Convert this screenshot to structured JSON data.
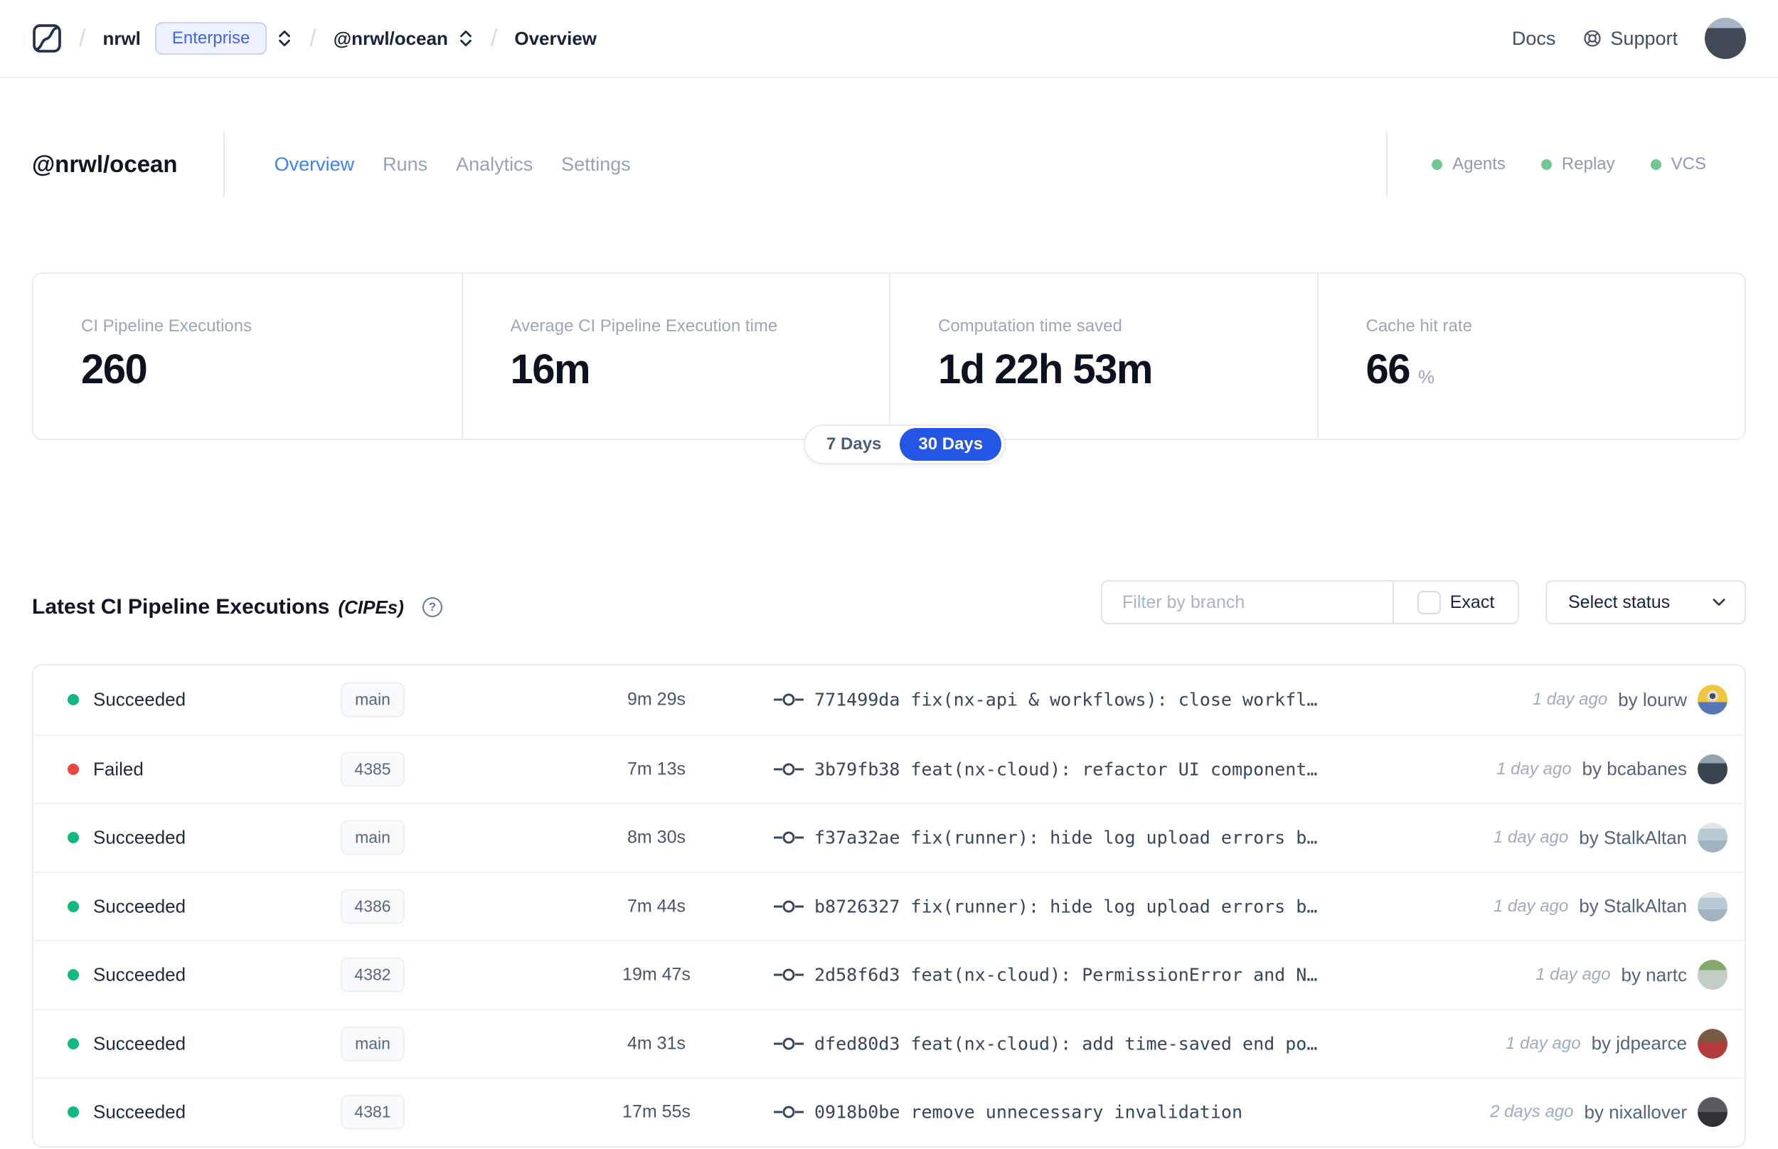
{
  "nav": {
    "breadcrumb": {
      "org": "nrwl",
      "org_badge": "Enterprise",
      "workspace": "@nrwl/ocean",
      "page": "Overview"
    },
    "links": {
      "docs": "Docs",
      "support": "Support"
    },
    "avatar_bg": "linear-gradient(180deg, #a7b6c4 0 25%, #414b58 25%)"
  },
  "header": {
    "title": "@nrwl/ocean",
    "tabs": [
      {
        "label": "Overview",
        "active": true
      },
      {
        "label": "Runs",
        "active": false
      },
      {
        "label": "Analytics",
        "active": false
      },
      {
        "label": "Settings",
        "active": false
      }
    ],
    "status_indicators": [
      {
        "label": "Agents",
        "color": "#6FC793"
      },
      {
        "label": "Replay",
        "color": "#6FC793"
      },
      {
        "label": "VCS",
        "color": "#6FC793"
      }
    ]
  },
  "stats": {
    "cards": [
      {
        "label": "CI Pipeline Executions",
        "value": "260",
        "suffix": ""
      },
      {
        "label": "Average CI Pipeline Execution time",
        "value": "16m",
        "suffix": ""
      },
      {
        "label": "Computation time saved",
        "value": "1d 22h 53m",
        "suffix": ""
      },
      {
        "label": "Cache hit rate",
        "value": "66",
        "suffix": "%"
      }
    ],
    "range_toggle": {
      "options": [
        "7 Days",
        "30 Days"
      ],
      "selected": "30 Days"
    }
  },
  "cipe_section": {
    "title": "Latest CI Pipeline Executions",
    "title_suffix": "(CIPEs)",
    "help_glyph": "?",
    "filter_placeholder": "Filter by branch",
    "exact_label": "Exact",
    "status_select_label": "Select status",
    "rows": [
      {
        "status": "Succeeded",
        "dot_color": "#10B981",
        "branch": "main",
        "duration": "9m 29s",
        "hash": "771499da",
        "message": "fix(nx-api & workflows): close workfl…",
        "time_ago": "1 day ago",
        "author": "by lourw",
        "avatar_bg": "radial-gradient(circle at 50% 38%, #4a4a4a 0 4px, #dddddd 4px 8px, transparent 8px), linear-gradient(180deg, #f2c63c 0 58%, #5577b5 58%)"
      },
      {
        "status": "Failed",
        "dot_color": "#EF4444",
        "branch": "4385",
        "duration": "7m 13s",
        "hash": "3b79fb38",
        "message": "feat(nx-cloud): refactor UI component…",
        "time_ago": "1 day ago",
        "author": "by bcabanes",
        "avatar_bg": "linear-gradient(180deg, #93a3ad 0 30%, #39444e 30%)"
      },
      {
        "status": "Succeeded",
        "dot_color": "#10B981",
        "branch": "main",
        "duration": "8m 30s",
        "hash": "f37a32ae",
        "message": "fix(runner): hide log upload errors b…",
        "time_ago": "1 day ago",
        "author": "by StalkAltan",
        "avatar_bg": "linear-gradient(180deg, #dfe7ec 0 20%, #b8c9d4 20% 60%, #9fb3c0 60%)"
      },
      {
        "status": "Succeeded",
        "dot_color": "#10B981",
        "branch": "4386",
        "duration": "7m 44s",
        "hash": "b8726327",
        "message": "fix(runner): hide log upload errors b…",
        "time_ago": "1 day ago",
        "author": "by StalkAltan",
        "avatar_bg": "linear-gradient(180deg, #dfe7ec 0 20%, #b8c9d4 20% 60%, #9fb3c0 60%)"
      },
      {
        "status": "Succeeded",
        "dot_color": "#10B981",
        "branch": "4382",
        "duration": "19m 47s",
        "hash": "2d58f6d3",
        "message": "feat(nx-cloud): PermissionError and N…",
        "time_ago": "1 day ago",
        "author": "by nartc",
        "avatar_bg": "linear-gradient(180deg, #86a86b 0 35%, #c2cdc6 35%)"
      },
      {
        "status": "Succeeded",
        "dot_color": "#10B981",
        "branch": "main",
        "duration": "4m 31s",
        "hash": "dfed80d3",
        "message": "feat(nx-cloud): add time-saved end po…",
        "time_ago": "1 day ago",
        "author": "by jdpearce",
        "avatar_bg": "linear-gradient(180deg, #7b5a44 0 45%, #b23b3b 45%)"
      },
      {
        "status": "Succeeded",
        "dot_color": "#10B981",
        "branch": "4381",
        "duration": "17m 55s",
        "hash": "0918b0be",
        "message": "remove unnecessary invalidation",
        "time_ago": "2 days ago",
        "author": "by nixallover",
        "avatar_bg": "linear-gradient(180deg, #5a5a60 0 50%, #303036 50%)"
      }
    ]
  },
  "colors": {
    "accent_blue": "#3B82F6",
    "toggle_blue": "#2456E5",
    "success_green": "#10B981",
    "fail_red": "#EF4444",
    "indicator_green": "#6FC793"
  }
}
